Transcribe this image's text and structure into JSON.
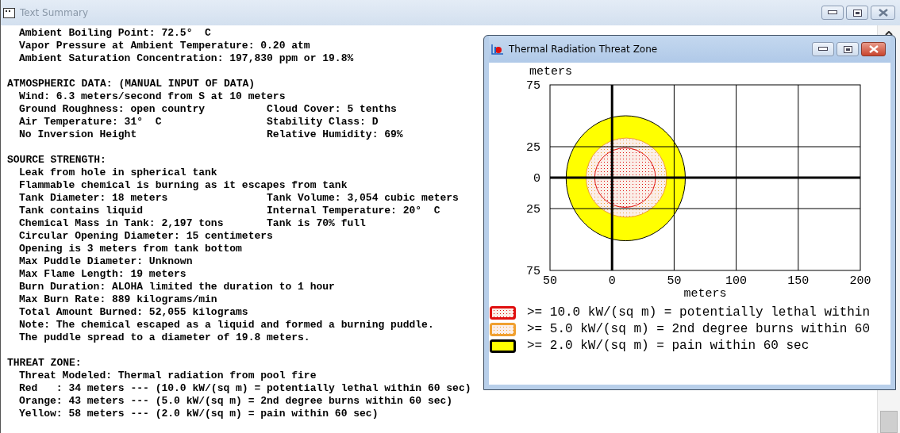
{
  "text_window": {
    "title": "Text Summary",
    "sections": [
      {
        "lines": [
          {
            "cells": [
              "Ambient Boiling Point: 72.5°  C"
            ]
          },
          {
            "cells": [
              "Vapor Pressure at Ambient Temperature: 0.20 atm"
            ]
          },
          {
            "cells": [
              "Ambient Saturation Concentration: 197,830 ppm or 19.8%"
            ]
          }
        ]
      },
      {
        "heading": "ATMOSPHERIC DATA: (MANUAL INPUT OF DATA)",
        "lines": [
          {
            "cells": [
              "Wind: 6.3 meters/second from S at 10 meters"
            ]
          },
          {
            "cells": [
              "Ground Roughness: open country",
              "Cloud Cover: 5 tenths"
            ]
          },
          {
            "cells": [
              "Air Temperature: 31°  C",
              "Stability Class: D"
            ]
          },
          {
            "cells": [
              "No Inversion Height",
              "Relative Humidity: 69%"
            ]
          }
        ]
      },
      {
        "heading": "SOURCE STRENGTH:",
        "lines": [
          {
            "cells": [
              "Leak from hole in spherical tank"
            ]
          },
          {
            "cells": [
              "Flammable chemical is burning as it escapes from tank"
            ]
          },
          {
            "cells": [
              "Tank Diameter: 18 meters",
              "Tank Volume: 3,054 cubic meters"
            ]
          },
          {
            "cells": [
              "Tank contains liquid",
              "Internal Temperature: 20°  C"
            ]
          },
          {
            "cells": [
              "Chemical Mass in Tank: 2,197 tons",
              "Tank is 70% full"
            ]
          },
          {
            "cells": [
              "Circular Opening Diameter: 15 centimeters"
            ]
          },
          {
            "cells": [
              "Opening is 3 meters from tank bottom"
            ]
          },
          {
            "cells": [
              "Max Puddle Diameter: Unknown"
            ]
          },
          {
            "cells": [
              "Max Flame Length: 19 meters"
            ]
          },
          {
            "cells": [
              "Burn Duration: ALOHA limited the duration to 1 hour"
            ]
          },
          {
            "cells": [
              "Max Burn Rate: 889 kilograms/min"
            ]
          },
          {
            "cells": [
              "Total Amount Burned: 52,055 kilograms"
            ]
          },
          {
            "cells": [
              "Note: The chemical escaped as a liquid and formed a burning puddle."
            ]
          },
          {
            "cells": [
              "The puddle spread to a diameter of 19.8 meters."
            ]
          }
        ]
      },
      {
        "heading": "THREAT ZONE:",
        "lines": [
          {
            "cells": [
              "Threat Modeled: Thermal radiation from pool fire"
            ]
          },
          {
            "cells": [
              "Red   : 34 meters --- (10.0 kW/(sq m) = potentially lethal within 60 sec)"
            ]
          },
          {
            "cells": [
              "Orange: 43 meters --- (5.0 kW/(sq m) = 2nd degree burns within 60 sec)"
            ]
          },
          {
            "cells": [
              "Yellow: 58 meters --- (2.0 kW/(sq m) = pain within 60 sec)"
            ]
          }
        ]
      }
    ]
  },
  "threat_window": {
    "title": "Thermal Radiation Threat Zone",
    "chart_data": {
      "type": "scatter",
      "xlabel": "meters",
      "ylabel": "meters",
      "xlim": [
        -50,
        200
      ],
      "ylim": [
        -75,
        75
      ],
      "xticks": [
        {
          "value": -50,
          "label": "50"
        },
        {
          "value": 0,
          "label": "0"
        },
        {
          "value": 50,
          "label": "50"
        },
        {
          "value": 100,
          "label": "100"
        },
        {
          "value": 150,
          "label": "150"
        },
        {
          "value": 200,
          "label": "200"
        }
      ],
      "yticks": [
        {
          "value": 75,
          "label": "75"
        },
        {
          "value": 25,
          "label": "25"
        },
        {
          "value": 0,
          "label": "0"
        },
        {
          "value": -25,
          "label": "25"
        },
        {
          "value": -75,
          "label": "75"
        }
      ],
      "grid": true
    },
    "legend": [
      {
        "kind": "dotted",
        "color": "#e01010",
        "text": ">= 10.0 kW/(sq m) = potentially lethal within"
      },
      {
        "kind": "dotted",
        "color": "#f0a030",
        "text": ">= 5.0 kW/(sq m) = 2nd degree burns within 60"
      },
      {
        "kind": "solid",
        "color": "#ffff00",
        "text": ">= 2.0 kW/(sq m) = pain within 60 sec"
      }
    ]
  }
}
